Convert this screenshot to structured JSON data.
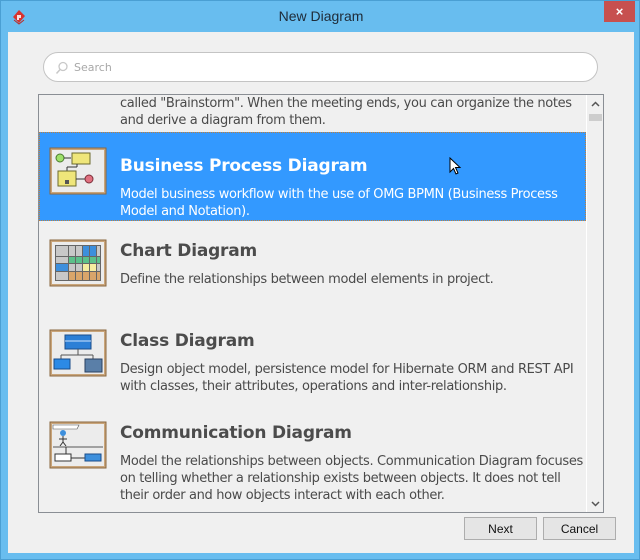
{
  "window": {
    "title": "New Diagram",
    "close_label": "×",
    "app_icon": "visual-paradigm-logo-icon"
  },
  "search": {
    "placeholder": "Search",
    "value": "",
    "icon": "search-icon"
  },
  "list": {
    "partial_item_description": "called \"Brainstorm\". When the meeting ends, you can organize the notes and derive a diagram from them.",
    "items": [
      {
        "name": "Business Process Diagram",
        "description": "Model business workflow with the use of OMG BPMN (Business Process Model and Notation).",
        "icon": "business-process-diagram-icon",
        "selected": true
      },
      {
        "name": "Chart Diagram",
        "description": "Define the relationships between model elements in project.",
        "icon": "chart-diagram-icon",
        "selected": false
      },
      {
        "name": "Class Diagram",
        "description": "Design object model, persistence model for Hibernate ORM and REST API with classes, their attributes, operations and inter-relationship.",
        "icon": "class-diagram-icon",
        "selected": false
      },
      {
        "name": "Communication Diagram",
        "description": "Model the relationships between objects. Communication Diagram focuses on telling whether a relationship exists between objects. It does not tell their order and how objects interact with each other.",
        "icon": "communication-diagram-icon",
        "selected": false
      }
    ]
  },
  "scrollbar": {
    "up_glyph": "⌃",
    "down_glyph": "⌄"
  },
  "buttons": {
    "next_label": "Next",
    "cancel_label": "Cancel"
  },
  "colors": {
    "title_bar": "#68bdef",
    "close_button": "#c7504f",
    "selection": "#3399ff",
    "dialog_background": "#f0f0f0"
  }
}
